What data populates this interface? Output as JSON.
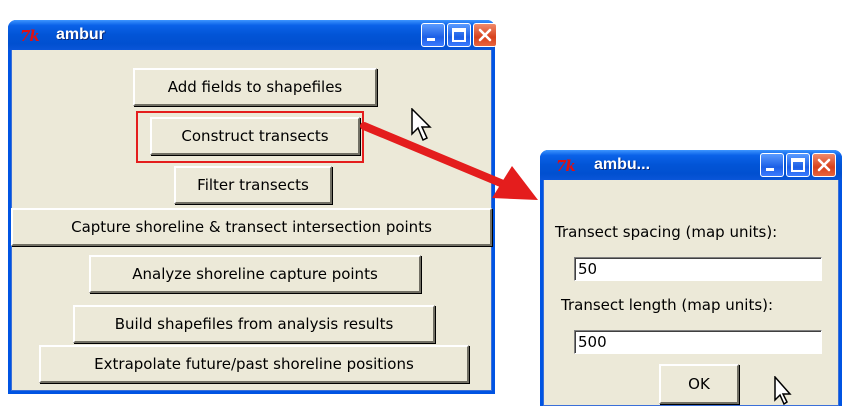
{
  "main_window": {
    "title": "ambur",
    "logo": "7k",
    "buttons": [
      "Add fields to shapefiles",
      "Construct transects",
      "Filter transects",
      "Capture shoreline & transect intersection points",
      "Analyze shoreline capture points",
      "Build shapefiles from analysis results",
      "Extrapolate future/past shoreline positions"
    ]
  },
  "dialog": {
    "title": "ambu...",
    "logo": "7k",
    "spacing_label": "Transect spacing (map units):",
    "spacing_value": "50",
    "length_label": "Transect length (map units):",
    "length_value": "500",
    "ok_label": "OK"
  },
  "colors": {
    "highlight": "#e41d1d",
    "arrow": "#e41d1d",
    "titlebar": "#0254d6",
    "window_bg": "#ece9d8"
  },
  "icons": [
    "tk-logo-icon",
    "minimize-icon",
    "maximize-icon",
    "close-icon",
    "mouse-pointer-icon",
    "annotation-arrow-icon"
  ]
}
